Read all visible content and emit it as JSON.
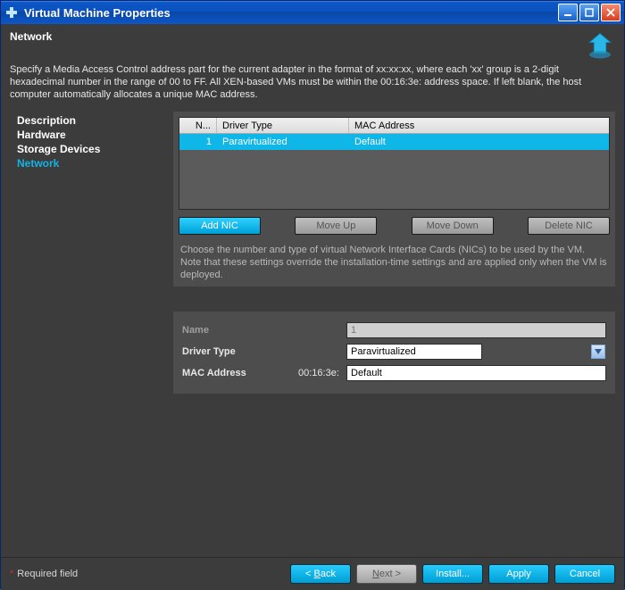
{
  "window": {
    "title": "Virtual Machine Properties"
  },
  "header": {
    "section": "Network",
    "help": "Specify a Media Access Control address part for the current adapter in the format of xx:xx:xx, where each 'xx' group is a 2-digit hexadecimal number in the range of 00 to FF. All XEN-based VMs must be within the 00:16:3e: address space. If left blank, the host computer automatically allocates a unique MAC address."
  },
  "sidebar": {
    "items": [
      {
        "label": "Description",
        "active": false
      },
      {
        "label": "Hardware",
        "active": false
      },
      {
        "label": "Storage Devices",
        "active": false
      },
      {
        "label": "Network",
        "active": true
      }
    ]
  },
  "nic_table": {
    "columns": {
      "num": "N...",
      "driver": "Driver Type",
      "mac": "MAC Address"
    },
    "rows": [
      {
        "num": "1",
        "driver": "Paravirtualized",
        "mac": "Default",
        "selected": true
      }
    ]
  },
  "nic_buttons": {
    "add": "Add NIC",
    "up": "Move Up",
    "down": "Move Down",
    "del": "Delete NIC"
  },
  "nic_hint": "Choose the number and type of virtual Network Interface Cards (NICs) to be used by the VM. Note that these settings override the installation-time settings and are applied only when the VM is deployed.",
  "form": {
    "name_label": "Name",
    "name_value": "1",
    "driver_label": "Driver Type",
    "driver_value": "Paravirtualized",
    "mac_label": "MAC Address",
    "mac_prefix": "00:16:3e:",
    "mac_value": "Default"
  },
  "footer": {
    "required": "Required field",
    "back": "< Back",
    "next": "Next >",
    "install": "Install...",
    "apply": "Apply",
    "cancel": "Cancel"
  }
}
